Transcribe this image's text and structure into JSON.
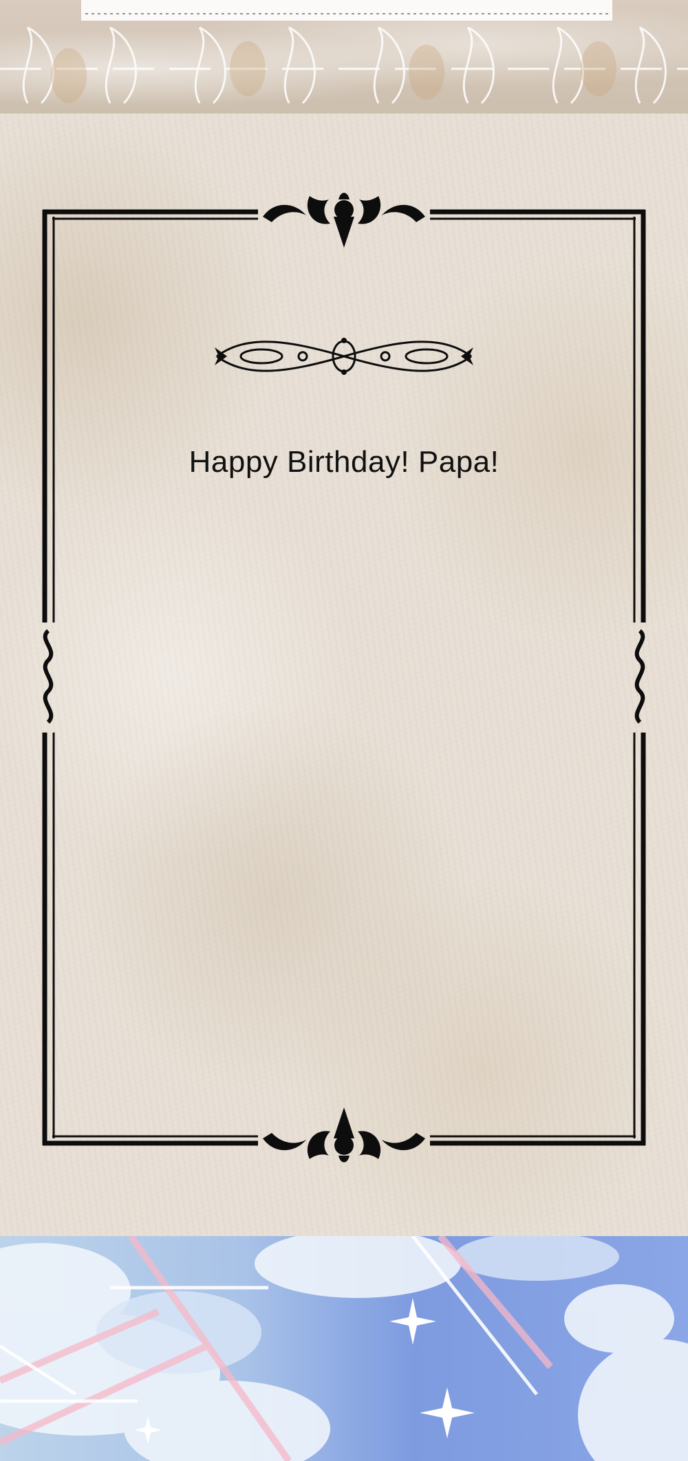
{
  "card": {
    "greeting": "Happy Birthday! Papa!"
  },
  "decor": {
    "top_band": "ornamental-lace-band",
    "frame": "double-line-border-with-flourishes",
    "divider": "filigree-divider",
    "bottom_panel": "sky-with-sparkles"
  },
  "colors": {
    "ink": "#111111",
    "parchment": "#e8e0d6",
    "sky_blue": "#7e9be0",
    "sparkle_pink": "#f7b8c8"
  }
}
